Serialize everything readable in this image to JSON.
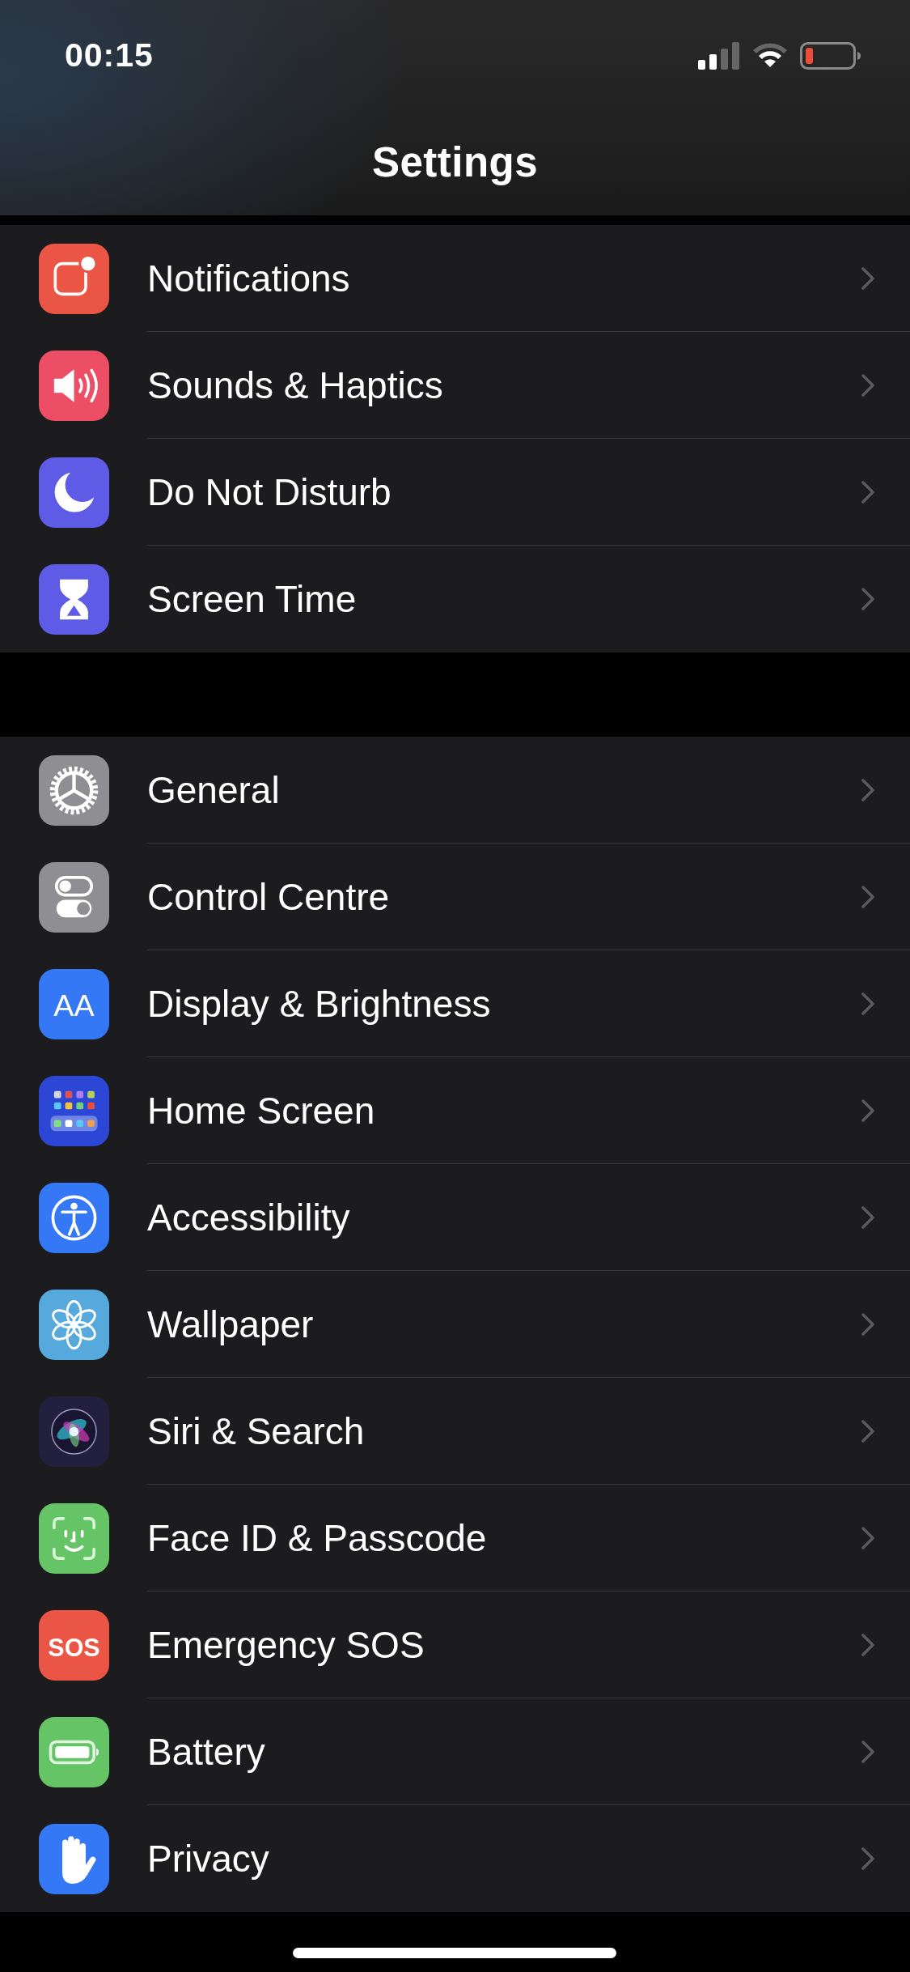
{
  "status_bar": {
    "time": "00:15"
  },
  "title": "Settings",
  "groups": [
    {
      "items": [
        {
          "label": "Notifications",
          "kind": "notifications",
          "color": "#eb5545"
        },
        {
          "label": "Sounds & Haptics",
          "kind": "speaker",
          "color": "#eb4e65"
        },
        {
          "label": "Do Not Disturb",
          "kind": "moon",
          "color": "#5e5ce6"
        },
        {
          "label": "Screen Time",
          "kind": "hourglass",
          "color": "#5e5ce6"
        }
      ]
    },
    {
      "items": [
        {
          "label": "General",
          "kind": "gear",
          "color": "#8e8e93"
        },
        {
          "label": "Control Centre",
          "kind": "toggles",
          "color": "#8e8e93"
        },
        {
          "label": "Display & Brightness",
          "kind": "letters",
          "icon_text": "AA",
          "color": "#3478f6"
        },
        {
          "label": "Home Screen",
          "kind": "grid",
          "color": "#2c47d6"
        },
        {
          "label": "Accessibility",
          "kind": "figure",
          "color": "#3478f6"
        },
        {
          "label": "Wallpaper",
          "kind": "flower",
          "color": "#56a9dd"
        },
        {
          "label": "Siri & Search",
          "kind": "orb",
          "color": "#231f3f"
        },
        {
          "label": "Face ID & Passcode",
          "kind": "face",
          "color": "#65c466"
        },
        {
          "label": "Emergency SOS",
          "kind": "sos",
          "icon_text": "SOS",
          "color": "#eb5545"
        },
        {
          "label": "Battery",
          "kind": "battery",
          "color": "#65c466"
        },
        {
          "label": "Privacy",
          "kind": "hand",
          "color": "#3478f6"
        }
      ]
    }
  ]
}
